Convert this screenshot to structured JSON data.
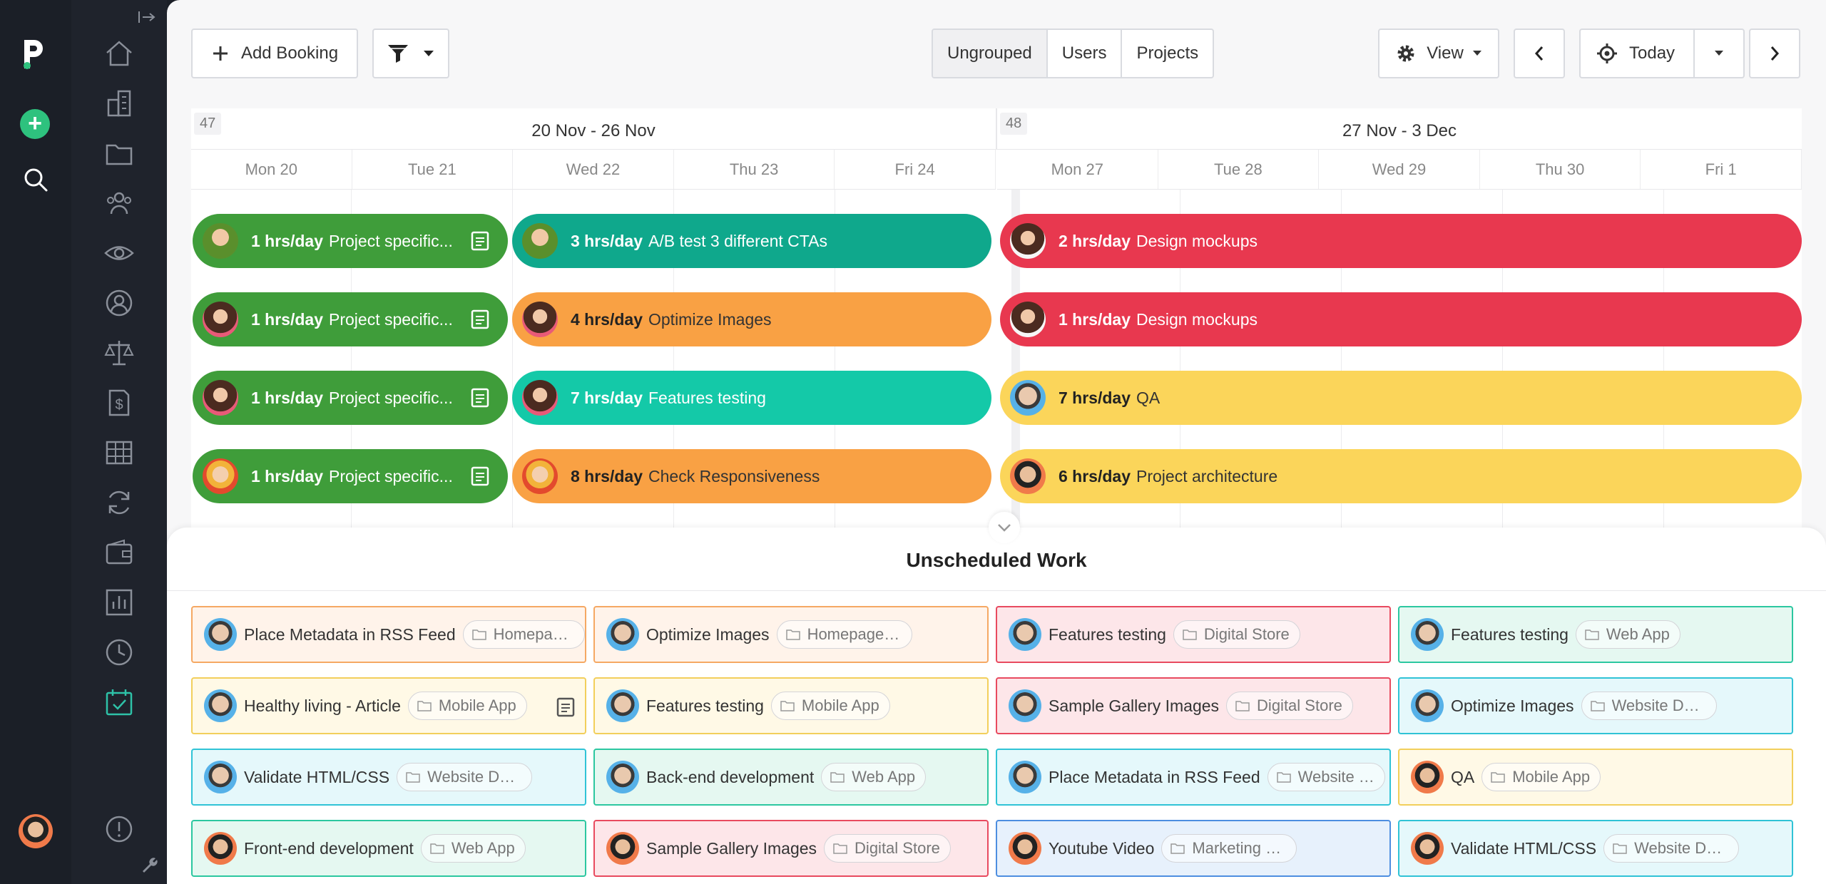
{
  "toolbar": {
    "add_booking_label": "Add Booking",
    "segments": [
      "Ungrouped",
      "Users",
      "Projects"
    ],
    "view_label": "View",
    "today_label": "Today"
  },
  "calendar": {
    "weeks": [
      {
        "number": "47",
        "label": "20 Nov - 26 Nov",
        "days": [
          "Mon 20",
          "Tue 21",
          "Wed 22",
          "Thu 23",
          "Fri 24"
        ]
      },
      {
        "number": "48",
        "label": "27 Nov - 3 Dec",
        "days": [
          "Mon 27",
          "Tue 28",
          "Wed 29",
          "Thu 30",
          "Fri 1"
        ]
      }
    ],
    "bookings": [
      {
        "hours": "1 hrs/day",
        "text": "Project specific...",
        "color": "#3f9d3a"
      },
      {
        "hours": "3 hrs/day",
        "text": "A/B test 3 different CTAs",
        "color": "#0fa88c"
      },
      {
        "hours": "2 hrs/day",
        "text": "Design mockups",
        "color": "#e8384f"
      },
      {
        "hours": "1 hrs/day",
        "text": "Project specific...",
        "color": "#3f9d3a"
      },
      {
        "hours": "4 hrs/day",
        "text": "Optimize Images",
        "color": "#f9a144"
      },
      {
        "hours": "1 hrs/day",
        "text": "Design mockups",
        "color": "#e8384f"
      },
      {
        "hours": "1 hrs/day",
        "text": "Project specific...",
        "color": "#3f9d3a"
      },
      {
        "hours": "7 hrs/day",
        "text": "Features testing",
        "color": "#14c9a8"
      },
      {
        "hours": "7 hrs/day",
        "text": "QA",
        "color": "#fbd55a"
      },
      {
        "hours": "1 hrs/day",
        "text": "Project specific...",
        "color": "#3f9d3a"
      },
      {
        "hours": "8 hrs/day",
        "text": "Check Responsiveness",
        "color": "#f9a144"
      },
      {
        "hours": "6 hrs/day",
        "text": "Project architecture",
        "color": "#fbd55a"
      }
    ]
  },
  "unscheduled": {
    "title": "Unscheduled Work",
    "cards": [
      {
        "task": "Place Metadata in RSS Feed",
        "project": "Homepag…",
        "color": "orange"
      },
      {
        "task": "Optimize Images",
        "project": "Homepage Design",
        "color": "orange"
      },
      {
        "task": "Features testing",
        "project": "Digital Store",
        "color": "red"
      },
      {
        "task": "Features testing",
        "project": "Web App",
        "color": "green"
      },
      {
        "task": "Healthy living - Article",
        "project": "Mobile App",
        "color": "yellow"
      },
      {
        "task": "Features testing",
        "project": "Mobile App",
        "color": "yellow"
      },
      {
        "task": "Sample Gallery Images",
        "project": "Digital Store",
        "color": "red"
      },
      {
        "task": "Optimize Images",
        "project": "Website Design",
        "color": "cyan"
      },
      {
        "task": "Validate HTML/CSS",
        "project": "Website Design",
        "color": "cyan"
      },
      {
        "task": "Back-end development",
        "project": "Web App",
        "color": "green"
      },
      {
        "task": "Place Metadata in RSS Feed",
        "project": "Website …",
        "color": "cyan"
      },
      {
        "task": "QA",
        "project": "Mobile App",
        "color": "yellow"
      },
      {
        "task": "Front-end development",
        "project": "Web App",
        "color": "green"
      },
      {
        "task": "Sample Gallery Images",
        "project": "Digital Store",
        "color": "red"
      },
      {
        "task": "Youtube Video",
        "project": "Marketing & Media",
        "color": "blue"
      },
      {
        "task": "Validate HTML/CSS",
        "project": "Website Design",
        "color": "cyan"
      }
    ]
  }
}
